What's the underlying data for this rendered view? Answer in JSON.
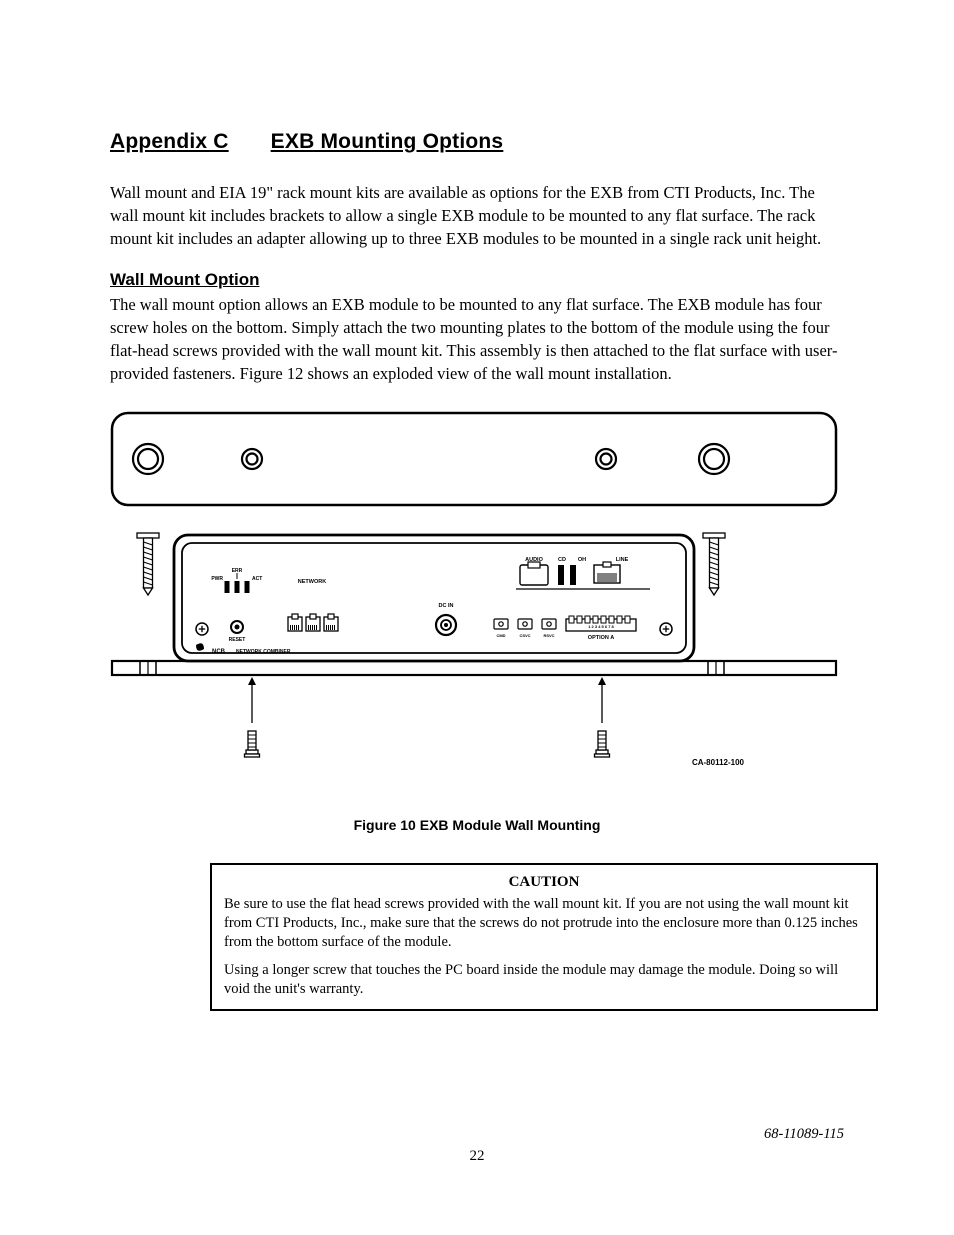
{
  "heading": {
    "appendix": "Appendix C",
    "title": "EXB Mounting Options"
  },
  "intro": "Wall mount and EIA 19\" rack mount kits are available as options for the EXB from CTI Products, Inc.  The wall mount kit includes brackets to allow a single EXB module to be mounted to any flat surface.  The rack mount kit includes an adapter allowing up to three EXB modules to be mounted in a single rack unit height.",
  "section": {
    "title": "Wall Mount Option",
    "body": "The wall mount option allows an EXB module to be mounted to any flat surface.  The EXB module has four screw holes on the bottom.  Simply attach the two mounting plates to the bottom of the module using the four flat-head screws provided with the wall mount kit.  This assembly is then attached to the flat surface with user-provided fasteners.  Figure 12 shows an exploded view of the wall mount installation."
  },
  "figure": {
    "caption": "Figure 10  EXB Module Wall Mounting",
    "drawing_number": "CA-80112-100",
    "panel_labels": {
      "err": "ERR",
      "pwr": "PWR",
      "act": "ACT",
      "network": "NETWORK",
      "dc_in": "DC IN",
      "reset": "RESET",
      "ncb": "NCB",
      "ncb_full": "NETWORK COMBINER",
      "audio": "AUDIO",
      "cd": "CD",
      "oh": "OH",
      "line": "LINE",
      "cmd": "CMD",
      "csvc": "CSVC",
      "rsvc": "RSVC",
      "option_a": "OPTION A",
      "dips": "1  2  3  4  5  6  7  8"
    }
  },
  "caution": {
    "title": "CAUTION",
    "p1": "Be sure to use the flat head screws provided with the wall mount kit.  If you are not using the wall mount kit from CTI Products, Inc., make sure that the screws do not protrude into the enclosure more than 0.125 inches from the bottom surface of the module.",
    "p2": "Using a longer screw that touches the PC board inside the module may damage the module.  Doing so will void the unit's warranty."
  },
  "footer": {
    "page": "22",
    "doc": "68-11089-115"
  }
}
